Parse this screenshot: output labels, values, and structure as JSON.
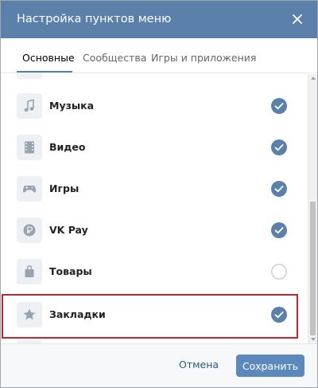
{
  "dialog": {
    "title": "Настройка пунктов меню",
    "close_icon": "close-icon"
  },
  "tabs": [
    {
      "label": "Основные",
      "active": true
    },
    {
      "label": "Сообщества",
      "active": false
    },
    {
      "label": "Игры и приложения",
      "active": false
    }
  ],
  "items": [
    {
      "label": "Музыка",
      "icon": "music-icon",
      "checked": true
    },
    {
      "label": "Видео",
      "icon": "video-icon",
      "checked": true
    },
    {
      "label": "Игры",
      "icon": "gamepad-icon",
      "checked": true
    },
    {
      "label": "VK Pay",
      "icon": "vk-pay-icon",
      "checked": true
    },
    {
      "label": "Товары",
      "icon": "shopping-bag-icon",
      "checked": false
    },
    {
      "label": "Закладки",
      "icon": "star-icon",
      "checked": true
    }
  ],
  "footer": {
    "cancel_label": "Отмена",
    "save_label": "Сохранить"
  },
  "colors": {
    "header": "#5b81ab",
    "accent": "#5181b8",
    "highlight": "#c1272d"
  }
}
